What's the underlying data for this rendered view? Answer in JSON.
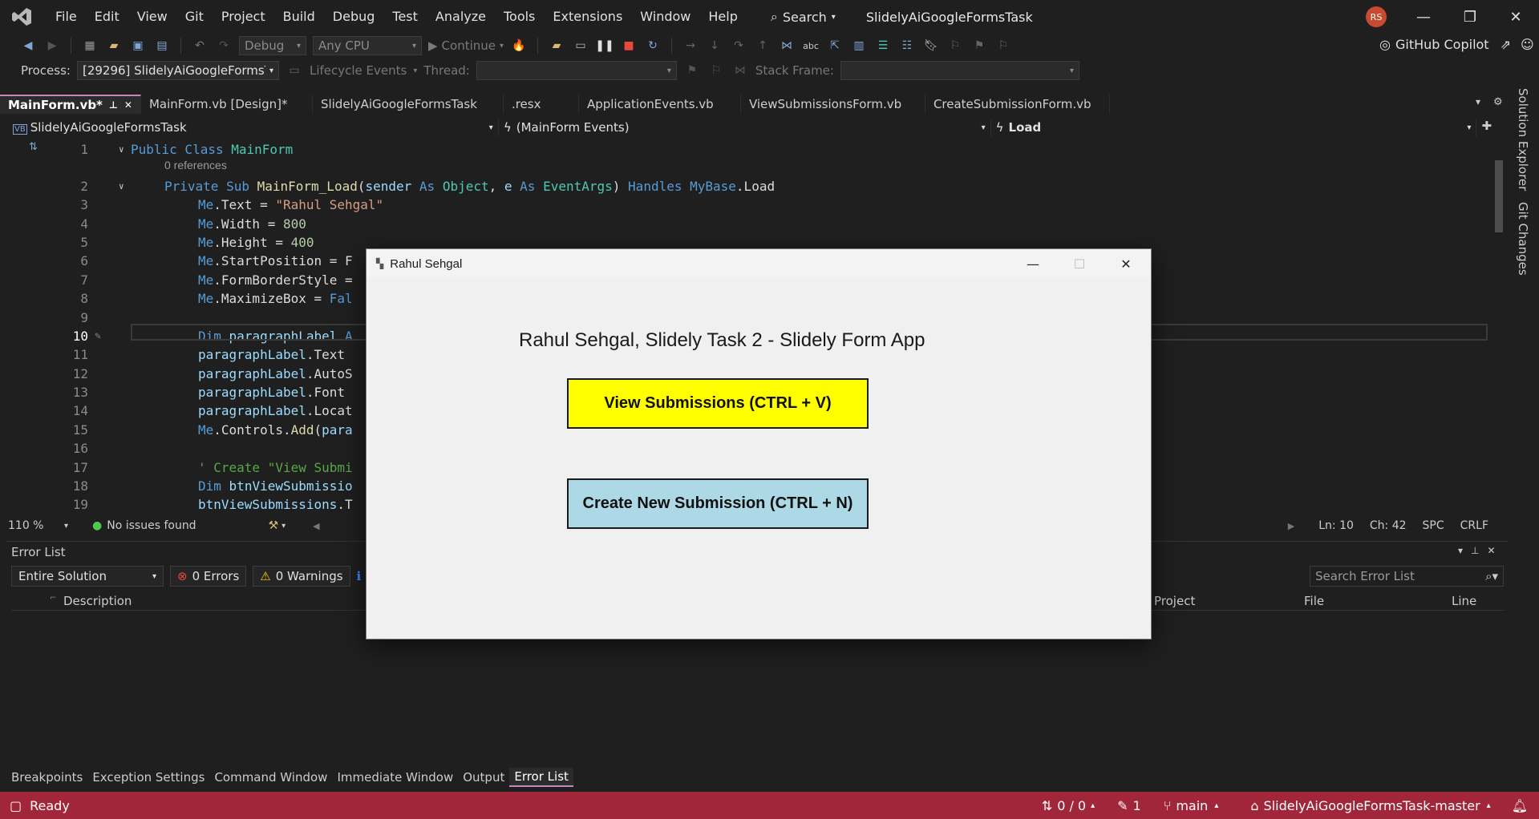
{
  "menu": {
    "items": [
      "File",
      "Edit",
      "View",
      "Git",
      "Project",
      "Build",
      "Debug",
      "Test",
      "Analyze",
      "Tools",
      "Extensions",
      "Window",
      "Help"
    ],
    "search_label": "Search",
    "window_title": "SlidelyAiGoogleFormsTask",
    "avatar_initials": "RS"
  },
  "toolbar": {
    "config": "Debug",
    "platform": "Any CPU",
    "continue_label": "Continue",
    "copilot_label": "GitHub Copilot"
  },
  "debug_bar": {
    "process_label": "Process:",
    "process_value": "[29296] SlidelyAiGoogleFormsTask",
    "lifecycle_label": "Lifecycle Events",
    "thread_label": "Thread:",
    "stackframe_label": "Stack Frame:"
  },
  "tabs": [
    {
      "label": "MainForm.vb*",
      "active": true
    },
    {
      "label": "MainForm.vb [Design]*",
      "active": false
    },
    {
      "label": "SlidelyAiGoogleFormsTask",
      "active": false
    },
    {
      "label": ".resx",
      "active": false
    },
    {
      "label": "ApplicationEvents.vb",
      "active": false
    },
    {
      "label": "ViewSubmissionsForm.vb",
      "active": false
    },
    {
      "label": "CreateSubmissionForm.vb",
      "active": false
    }
  ],
  "navbar": {
    "project": "SlidelyAiGoogleFormsTask",
    "events": "(MainForm Events)",
    "member": "Load"
  },
  "side_tabs": [
    "Solution Explorer",
    "Git Changes"
  ],
  "code": {
    "references": "0 references",
    "line_numbers": [
      "1",
      "2",
      "3",
      "4",
      "5",
      "6",
      "7",
      "8",
      "9",
      "10",
      "11",
      "12",
      "13",
      "14",
      "15",
      "16",
      "17",
      "18",
      "19"
    ]
  },
  "editor_status": {
    "zoom": "110 %",
    "issues": "No issues found",
    "line": "Ln: 10",
    "char": "Ch: 42",
    "spacing": "SPC",
    "eol": "CRLF"
  },
  "error_list": {
    "title": "Error List",
    "scope": "Entire Solution",
    "errors": "0 Errors",
    "warnings": "0 Warnings",
    "search_placeholder": "Search Error List",
    "columns": [
      "Description",
      "Project",
      "File",
      "Line"
    ]
  },
  "bottom_tabs": [
    "Breakpoints",
    "Exception Settings",
    "Command Window",
    "Immediate Window",
    "Output",
    "Error List"
  ],
  "statusbar": {
    "ready": "Ready",
    "sync": "0 / 0",
    "edits": "1",
    "branch": "main",
    "repo": "SlidelyAiGoogleFormsTask-master"
  },
  "form": {
    "title": "Rahul Sehgal",
    "heading": "Rahul Sehgal, Slidely Task 2 - Slidely Form App",
    "view_button": "View Submissions (CTRL + V)",
    "create_button": "Create New Submission (CTRL + N)"
  },
  "colors": {
    "statusbar": "#a1263a",
    "view_button": "#ffff00",
    "create_button": "#add8e6"
  }
}
